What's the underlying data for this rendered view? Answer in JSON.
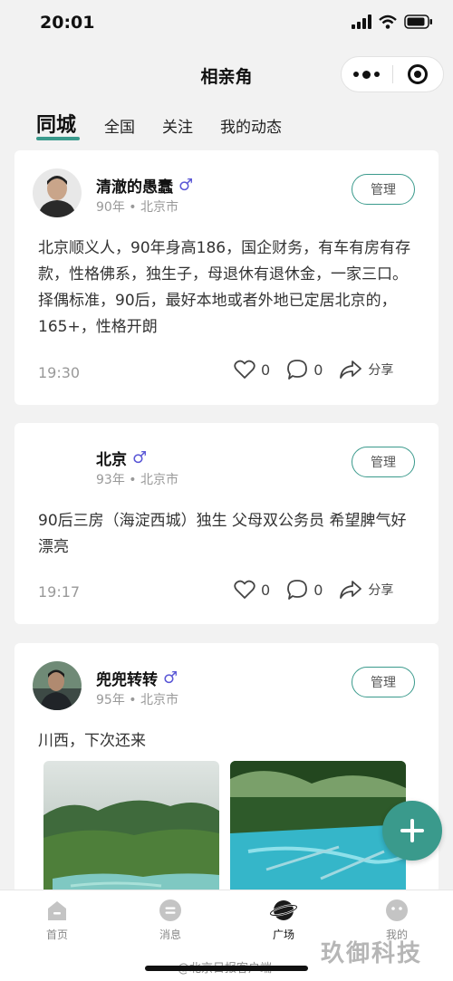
{
  "status_bar": {
    "time": "20:01"
  },
  "nav": {
    "title": "相亲角"
  },
  "tabs": [
    {
      "label": "同城",
      "active": true
    },
    {
      "label": "全国",
      "active": false
    },
    {
      "label": "关注",
      "active": false
    },
    {
      "label": "我的动态",
      "active": false
    }
  ],
  "posts": [
    {
      "name": "清澈的愚蠢",
      "gender": "♂",
      "year": "90年",
      "city": "北京市",
      "manage_label": "管理",
      "text": "北京顺义人，90年身高186，国企财务，有车有房有存款，性格佛系，独生子，母退休有退休金，一家三口。择偶标准，90后，最好本地或者外地已定居北京的，165+，性格开朗",
      "time": "19:30",
      "likes": "0",
      "comments": "0",
      "share_label": "分享"
    },
    {
      "name": "北京",
      "gender": "♂",
      "year": "93年",
      "city": "北京市",
      "manage_label": "管理",
      "text": "90后三房（海淀西城）独生 父母双公务员 希望脾气好漂亮",
      "time": "19:17",
      "likes": "0",
      "comments": "0",
      "share_label": "分享"
    },
    {
      "name": "兜兜转转",
      "gender": "♂",
      "year": "95年",
      "city": "北京市",
      "manage_label": "管理",
      "text": "川西，下次还来"
    }
  ],
  "meta_separator": "•",
  "tab_bar": [
    {
      "label": "首页",
      "icon": "home-icon",
      "active": false
    },
    {
      "label": "消息",
      "icon": "message-icon",
      "active": false
    },
    {
      "label": "广场",
      "icon": "planet-icon",
      "active": true
    },
    {
      "label": "我的",
      "icon": "profile-icon",
      "active": false
    }
  ],
  "watermarks": {
    "weibo": "@北京日报客户端",
    "brand": "玖御科技"
  },
  "colors": {
    "accent": "#3a9a8c",
    "male": "#5a57d6"
  }
}
